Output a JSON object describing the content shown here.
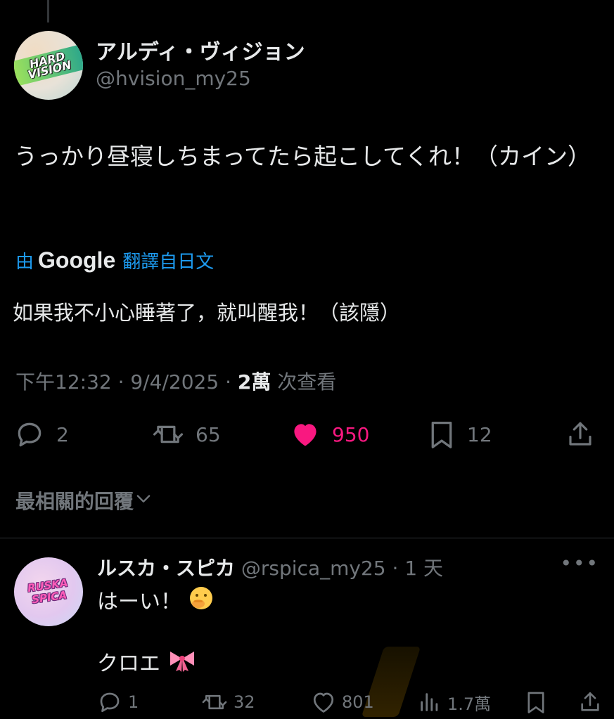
{
  "author": {
    "display_name": "アルディ・ヴィジョン",
    "handle": "@hvision_my25",
    "avatar_text": "HARD VISION"
  },
  "tweet": {
    "text": "うっかり昼寝しちまってたら起こしてくれ！（カイン）",
    "translate_prefix": "由",
    "translate_brand": "Google",
    "translate_suffix": "翻譯自日文",
    "translated_text": "如果我不小心睡著了，就叫醒我！（該隱）",
    "time": "下午12:32",
    "date": "9/4/2025",
    "views_count": "2萬",
    "views_label": "次查看"
  },
  "actions": {
    "replies": "2",
    "reposts": "65",
    "likes": "950",
    "bookmarks": "12"
  },
  "colors": {
    "accent": "#1d9bf0",
    "like": "#f91880",
    "muted": "#71767b",
    "text": "#e7e9ea",
    "background": "#000000"
  },
  "sort": {
    "label": "最相關的回覆"
  },
  "reply": {
    "display_name": "ルスカ・スピカ",
    "handle": "@rspica_my25",
    "time": "1 天",
    "avatar_text": "RUSKA SPICA",
    "line1": "はーい！",
    "line2": "クロエ",
    "emoji1": "hand-over-mouth-emoji",
    "emoji2": "ribbon-emoji",
    "replies": "1",
    "reposts": "32",
    "likes": "801",
    "views": "1.7萬"
  }
}
